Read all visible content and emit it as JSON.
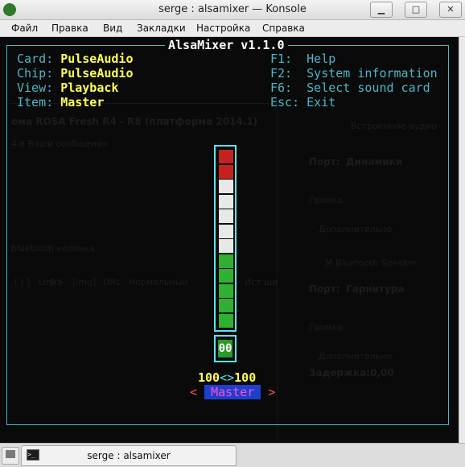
{
  "window": {
    "title": "serge : alsamixer — Konsole",
    "minimize_glyph": "▁",
    "maximize_glyph": "□",
    "close_glyph": "✕"
  },
  "menu": [
    "Файл",
    "Правка",
    "Вид",
    "Закладки",
    "Настройка",
    "Справка"
  ],
  "mixer": {
    "title": "AlsaMixer v1.1.0",
    "info": [
      {
        "label": "Card:",
        "value": "PulseAudio"
      },
      {
        "label": "Chip:",
        "value": "PulseAudio"
      },
      {
        "label": "View:",
        "value": "Playback"
      },
      {
        "label": "Item:",
        "value": "Master"
      }
    ],
    "keys": [
      {
        "key": "F1:",
        "action": "Help"
      },
      {
        "key": "F2:",
        "action": "System information"
      },
      {
        "key": "F6:",
        "action": "Select sound card"
      },
      {
        "key": "Esc:",
        "action": "Exit"
      }
    ],
    "volume_fraction": 1.0,
    "mute_value": "00",
    "left_level": "100",
    "level_sep": "<>",
    "right_level": "100",
    "channel_left_arrow": "<",
    "channel_name": "Master",
    "channel_right_arrow": ">"
  },
  "background_ghost": {
    "headline": "ома ROSA Fresh R4 - R8 (платформа 2014.1)",
    "subline": "4 в Ваши сообщения",
    "bt_line": "bluetooth колонка",
    "toolbar_items": [
      "[ | ]",
      "Link>",
      "[*]",
      "[img]",
      "URL",
      "Нормальный",
      "Ист ши"
    ],
    "right_title": "Встроенное аудио",
    "port1_label": "Порт:",
    "port1_value": "Динамики",
    "section1": "Громко",
    "more1": "Дополнительно",
    "device2": "M Bluetooth Speaker",
    "port2_label": "Порт:",
    "port2_value": "Гарнитура",
    "section2": "Громко",
    "more2": "Дополнительно",
    "delay_label": "Задержка:",
    "delay_value": "0,00",
    "right_top_letter": "П"
  },
  "tabs": [
    {
      "label": "serge : alsamixer"
    }
  ]
}
